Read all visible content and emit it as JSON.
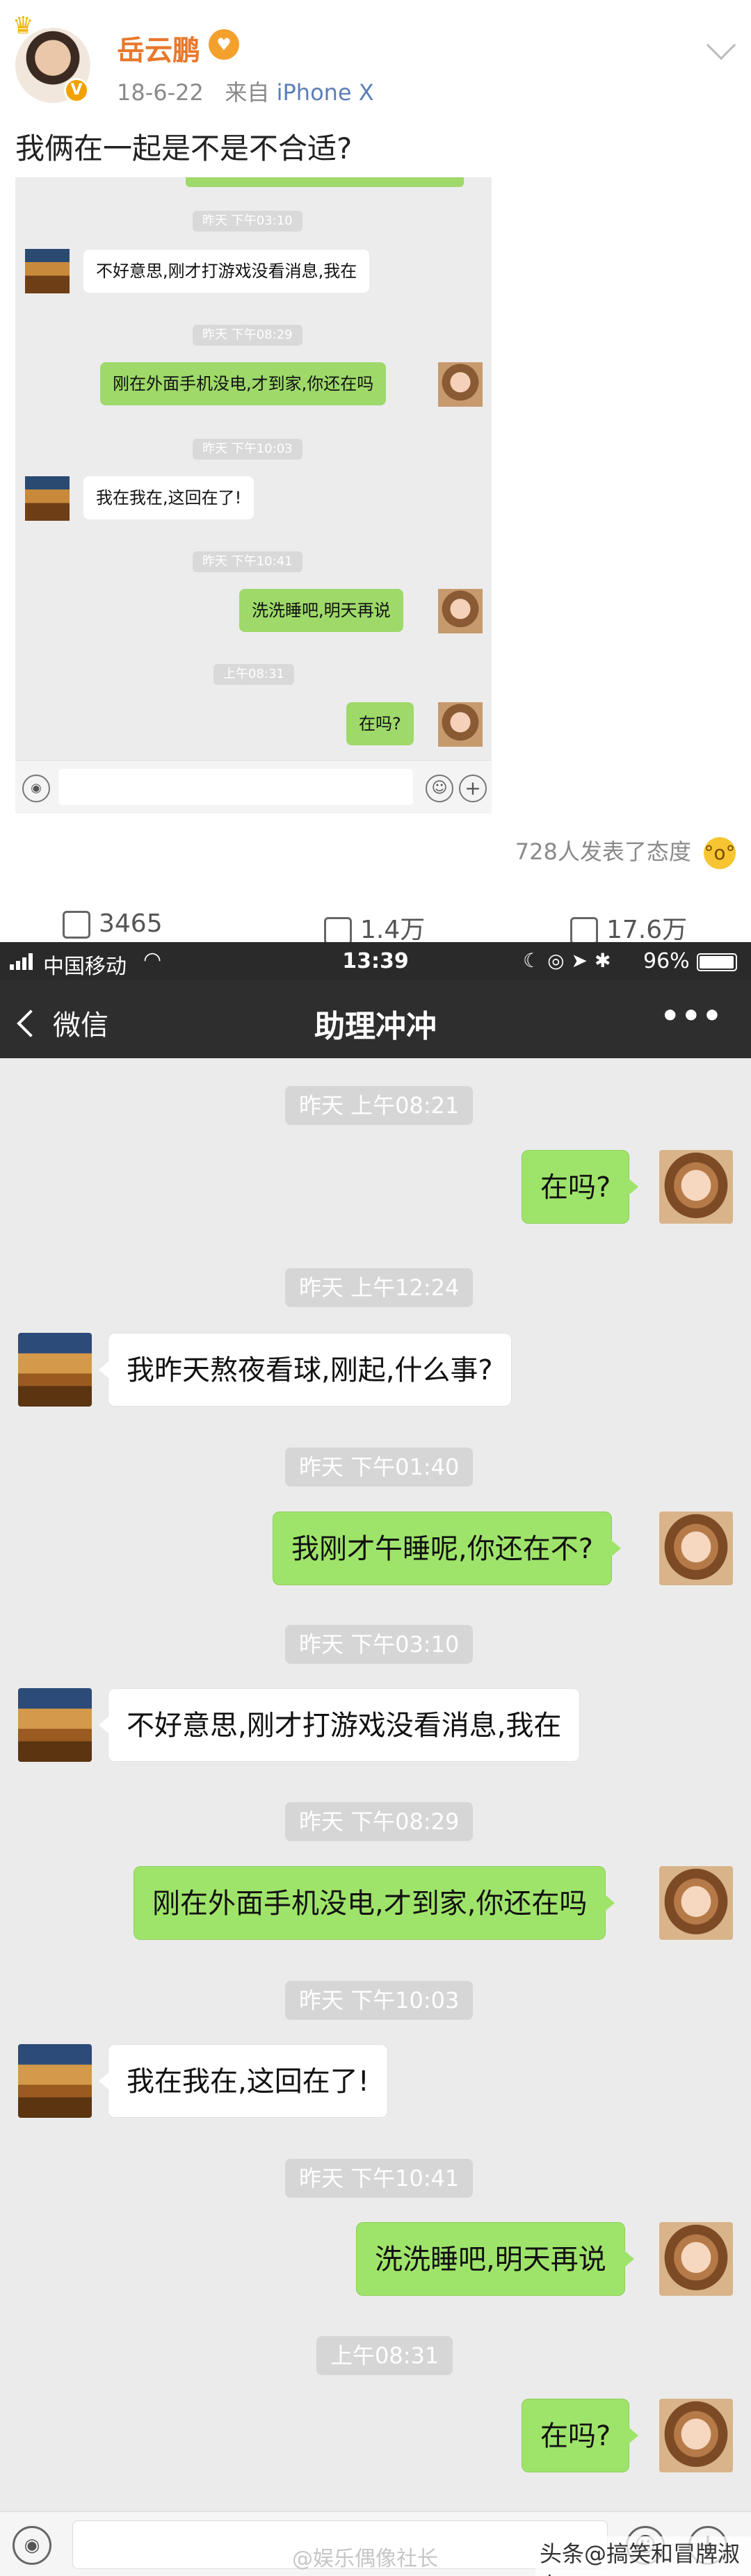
{
  "weibo": {
    "author": "岳云鹏",
    "date": "18-6-22",
    "source_prefix": "来自",
    "source": "iPhone X",
    "text": "我俩在一起是不是不合适?",
    "reactions": "728人发表了态度",
    "repost_count": "3465",
    "comment_count": "1.4万",
    "like_count": "17.6万"
  },
  "thumb": {
    "messages": [
      {
        "time": "昨天 下午03:10"
      },
      {
        "side": "in",
        "text": "不好意思,刚才打游戏没看消息,我在"
      },
      {
        "time": "昨天 下午08:29"
      },
      {
        "side": "out",
        "text": "刚在外面手机没电,才到家,你还在吗"
      },
      {
        "time": "昨天 下午10:03"
      },
      {
        "side": "in",
        "text": "我在我在,这回在了!"
      },
      {
        "time": "昨天 下午10:41"
      },
      {
        "side": "out",
        "text": "洗洗睡吧,明天再说"
      },
      {
        "time": "上午08:31"
      },
      {
        "side": "out",
        "text": "在吗?"
      }
    ]
  },
  "status": {
    "carrier": "中国移动",
    "time": "13:39",
    "battery": "96%"
  },
  "nav": {
    "back": "微信",
    "title": "助理冲冲",
    "more": "•••"
  },
  "chat": {
    "t1": "昨天 上午08:21",
    "m1": "在吗?",
    "t2": "昨天 上午12:24",
    "m2": "我昨天熬夜看球,刚起,什么事?",
    "t3": "昨天 下午01:40",
    "m3": "我刚才午睡呢,你还在不?",
    "t4": "昨天 下午03:10",
    "m4": "不好意思,刚才打游戏没看消息,我在",
    "t5": "昨天 下午08:29",
    "m5": "刚在外面手机没电,才到家,你还在吗",
    "t6": "昨天 下午10:03",
    "m6": "我在我在,这回在了!",
    "t7": "昨天 下午10:41",
    "m7": "洗洗睡吧,明天再说",
    "t8": "上午08:31",
    "m8": "在吗?"
  },
  "watermark": {
    "weibo": "@娱乐偶像社长",
    "toutiao": "头条@搞笑和冒牌淑女"
  },
  "icons": [
    "crown-icon",
    "v-badge-icon",
    "chevron-down-icon",
    "voice-icon",
    "emoji-icon",
    "plus-icon",
    "wifi-icon",
    "battery-icon",
    "back-icon",
    "more-icon",
    "repost-icon",
    "comment-icon",
    "like-icon"
  ]
}
